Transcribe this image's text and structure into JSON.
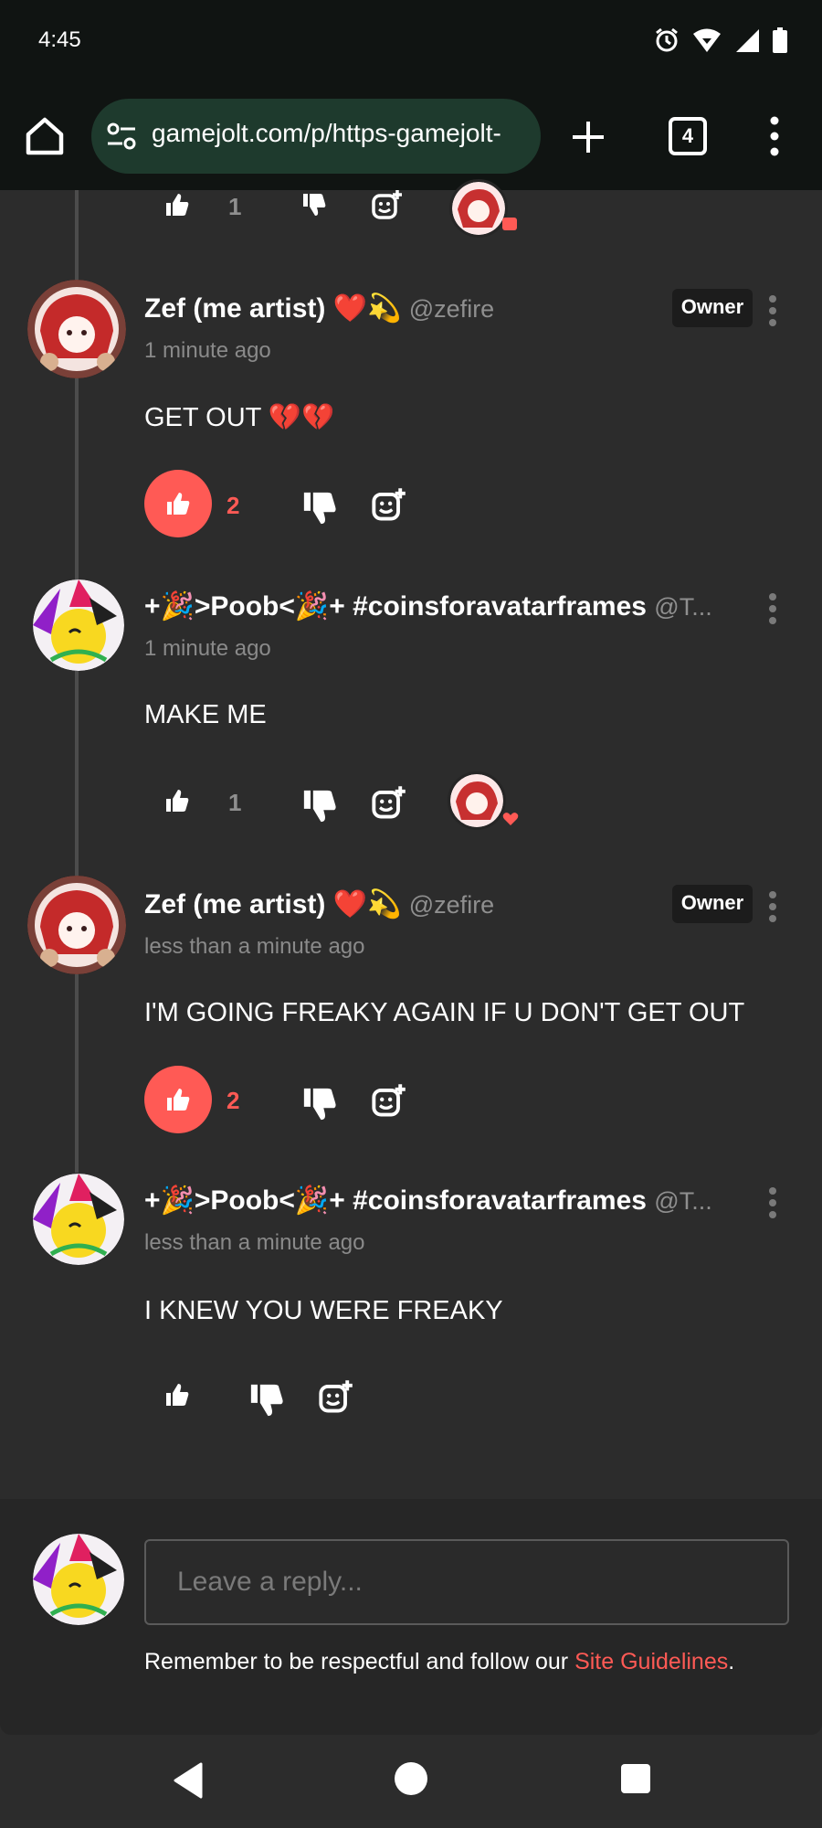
{
  "status_bar": {
    "time": "4:45",
    "icons": [
      "alarm-icon",
      "wifi-icon",
      "signal-icon",
      "battery-icon"
    ]
  },
  "browser": {
    "url": "gamejolt.com/p/https-gamejolt-",
    "tab_count": "4",
    "icons": [
      "home-icon",
      "site-settings-icon",
      "new-tab-icon",
      "more-vert-icon"
    ]
  },
  "colors": {
    "accent": "#ff5a55",
    "background": "#2c2c2c",
    "url_pill": "#1e3a2d"
  },
  "top_partial_row": {
    "like_count": "1"
  },
  "comments": [
    {
      "author": "Zef (me artist) ❤️💫",
      "handle": "@zefire",
      "badge": "Owner",
      "timestamp": "1 minute ago",
      "body": "GET OUT 💔💔",
      "likes": "2",
      "liked": true
    },
    {
      "author": "+🎉>Poob<🎉+ #coinsforavatarframes",
      "handle": "@T...",
      "badge": "",
      "timestamp": "1 minute ago",
      "body": "MAKE ME",
      "likes": "1",
      "liked": false
    },
    {
      "author": "Zef (me artist) ❤️💫",
      "handle": "@zefire",
      "badge": "Owner",
      "timestamp": "less than a minute ago",
      "body": "I'M GOING FREAKY AGAIN IF U DON'T GET OUT",
      "likes": "2",
      "liked": true
    },
    {
      "author": "+🎉>Poob<🎉+ #coinsforavatarframes",
      "handle": "@T...",
      "badge": "",
      "timestamp": "less than a minute ago",
      "body": "I KNEW YOU WERE FREAKY",
      "likes": "",
      "liked": false
    }
  ],
  "reply": {
    "placeholder": "Leave a reply...",
    "note_prefix": "Remember to be respectful and follow our ",
    "note_link": "Site Guidelines",
    "note_suffix": "."
  },
  "nav": {
    "icons": [
      "back-icon",
      "home-circle-icon",
      "recents-icon"
    ]
  }
}
